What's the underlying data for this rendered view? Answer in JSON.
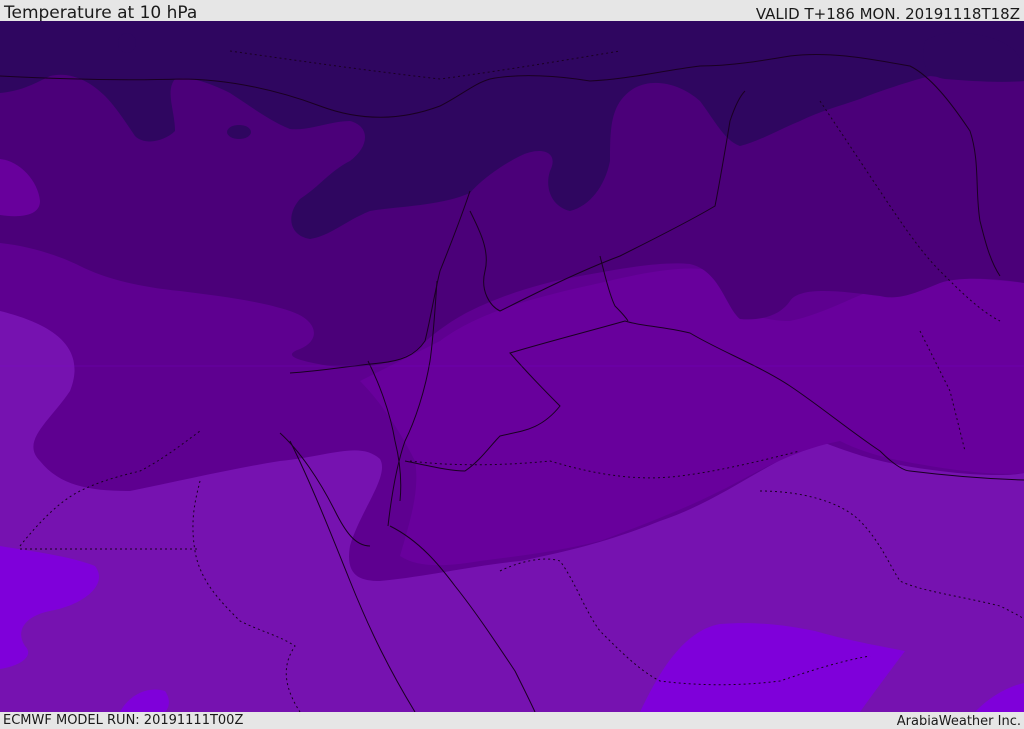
{
  "header": {
    "title": "Temperature at 10 hPa",
    "valid": "VALID T+186 MON. 20191118T18Z"
  },
  "footer": {
    "model_run": "ECMWF MODEL RUN: 20191111T00Z",
    "credit": "ArabiaWeather Inc."
  },
  "map": {
    "colors": {
      "darkest": "#2f0660",
      "dark": "#4b0079",
      "medium": "#5e0090",
      "medium_light": "#68009c",
      "light": "#7612b0",
      "lightest": "#7f00da",
      "border_line": "#1a0022"
    }
  }
}
